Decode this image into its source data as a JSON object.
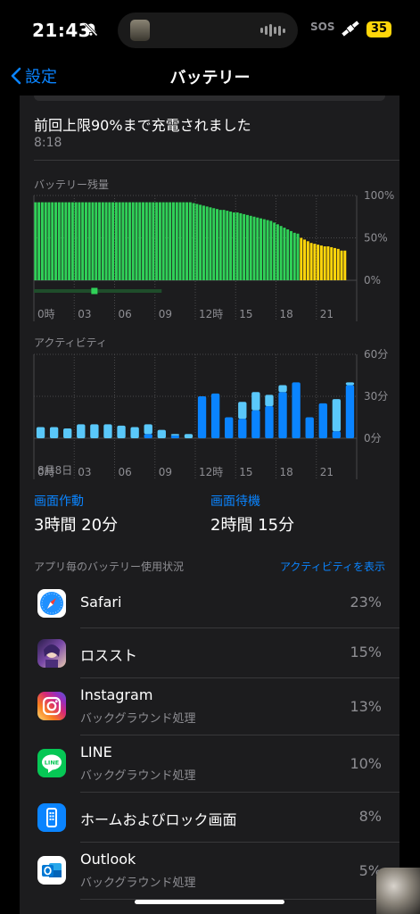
{
  "status_bar": {
    "time": "21:43",
    "sos": "SOS",
    "battery": "35",
    "icons": [
      "bell-slash-icon",
      "satellite-icon"
    ]
  },
  "nav": {
    "back_label": "設定",
    "title": "バッテリー"
  },
  "charge": {
    "title": "前回上限90%まで充電されました",
    "time": "8:18"
  },
  "battery_section": {
    "label": "バッテリー残量"
  },
  "activity_section": {
    "label": "アクティビティ",
    "date": "8月8日"
  },
  "chart_data": [
    {
      "type": "bar",
      "title": "バッテリー残量",
      "x_ticks": [
        "0時",
        "03",
        "06",
        "09",
        "12時",
        "15",
        "18",
        "21"
      ],
      "y_ticks": [
        "100%",
        "50%",
        "0%"
      ],
      "ylim": [
        0,
        100
      ],
      "values": [
        92,
        92,
        92,
        92,
        92,
        92,
        92,
        92,
        92,
        92,
        92,
        92,
        92,
        92,
        92,
        92,
        92,
        92,
        92,
        92,
        92,
        92,
        92,
        92,
        92,
        92,
        92,
        92,
        92,
        92,
        92,
        92,
        92,
        92,
        92,
        92,
        92,
        92,
        92,
        92,
        92,
        92,
        92,
        92,
        92,
        92,
        92,
        91,
        90,
        89,
        88,
        87,
        86,
        85,
        84,
        83,
        83,
        82,
        81,
        80,
        80,
        79,
        78,
        77,
        76,
        75,
        74,
        73,
        72,
        71,
        70,
        68,
        66,
        64,
        62,
        60,
        58,
        56,
        55,
        50,
        48,
        46,
        44,
        43,
        42,
        41,
        40,
        40,
        39,
        38,
        37,
        35,
        35
      ],
      "series_colors": {
        "normal": "#30d158",
        "low_power": "#ffd60a"
      },
      "low_power_from_index": 79,
      "charging_markers": [
        {
          "start_hour": 0,
          "end_hour": 9.5
        },
        {
          "at_hour": 4.5
        }
      ]
    },
    {
      "type": "bar",
      "title": "アクティビティ",
      "x_ticks": [
        "0時",
        "03",
        "06",
        "09",
        "12時",
        "15",
        "18",
        "21"
      ],
      "y_ticks": [
        "60分",
        "30分",
        "0分"
      ],
      "ylim": [
        0,
        60
      ],
      "series": [
        {
          "name": "画面作動",
          "color": "#0a84ff",
          "values": [
            0,
            0,
            0,
            0,
            0,
            0,
            0,
            0,
            3,
            0,
            2,
            0,
            30,
            32,
            15,
            14,
            20,
            23,
            33,
            40,
            15,
            25,
            5,
            38
          ]
        },
        {
          "name": "画面待機",
          "color": "#5ac8fa",
          "values": [
            8,
            8,
            7,
            10,
            10,
            10,
            9,
            8,
            7,
            6,
            1,
            3,
            0,
            0,
            0,
            12,
            13,
            8,
            5,
            0,
            0,
            0,
            23,
            2
          ]
        }
      ]
    }
  ],
  "screen_time": {
    "active_label": "画面作動",
    "active_value": "3時間 20分",
    "idle_label": "画面待機",
    "idle_value": "2時間 15分"
  },
  "usage": {
    "header": "アプリ毎のバッテリー使用状況",
    "link": "アクティビティを表示",
    "apps": [
      {
        "name": "Safari",
        "sub": "",
        "pct": "23%",
        "icon": "safari-icon"
      },
      {
        "name": "ロススト",
        "sub": "",
        "pct": "15%",
        "icon": "game-icon"
      },
      {
        "name": "Instagram",
        "sub": "バックグラウンド処理",
        "pct": "13%",
        "icon": "instagram-icon"
      },
      {
        "name": "LINE",
        "sub": "バックグラウンド処理",
        "pct": "10%",
        "icon": "line-icon"
      },
      {
        "name": "ホームおよびロック画面",
        "sub": "",
        "pct": "8%",
        "icon": "home-lock-icon"
      },
      {
        "name": "Outlook",
        "sub": "バックグラウンド処理",
        "pct": "5%",
        "icon": "outlook-icon"
      }
    ]
  }
}
